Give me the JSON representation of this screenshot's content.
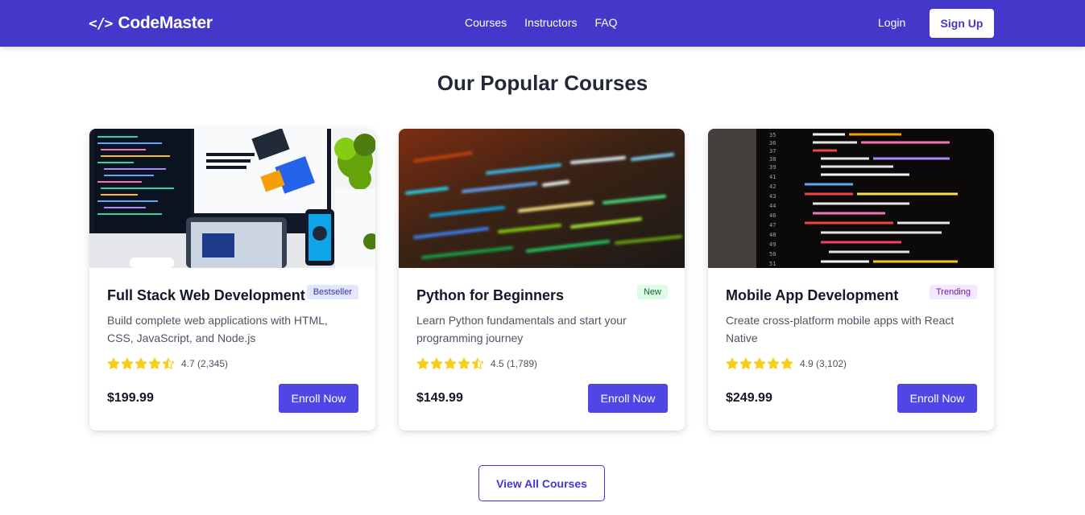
{
  "header": {
    "logo_icon": "</>",
    "logo_text": "CodeMaster",
    "nav": [
      {
        "label": "Courses"
      },
      {
        "label": "Instructors"
      },
      {
        "label": "FAQ"
      }
    ],
    "login_label": "Login",
    "signup_label": "Sign Up"
  },
  "section": {
    "title": "Our Popular Courses"
  },
  "courses": [
    {
      "title": "Full Stack Web Development",
      "badge": "Bestseller",
      "description": "Build complete web applications with HTML, CSS, JavaScript, and Node.js",
      "rating": 4.7,
      "rating_text": "4.7 (2,345)",
      "price": "$199.99",
      "enroll_label": "Enroll Now",
      "image": "desktop-workspace-photo"
    },
    {
      "title": "Python for Beginners",
      "badge": "New",
      "description": "Learn Python fundamentals and start your programming journey",
      "rating": 4.5,
      "rating_text": "4.5 (1,789)",
      "price": "$149.99",
      "enroll_label": "Enroll Now",
      "image": "blurred-code-photo"
    },
    {
      "title": "Mobile App Development",
      "badge": "Trending",
      "description": "Create cross-platform mobile apps with React Native",
      "rating": 4.9,
      "rating_text": "4.9 (3,102)",
      "price": "$249.99",
      "enroll_label": "Enroll Now",
      "image": "code-editor-photo"
    }
  ],
  "view_all_label": "View All Courses",
  "colors": {
    "brand": "#4338ca",
    "button": "#4f46e5",
    "star": "#facc15"
  }
}
